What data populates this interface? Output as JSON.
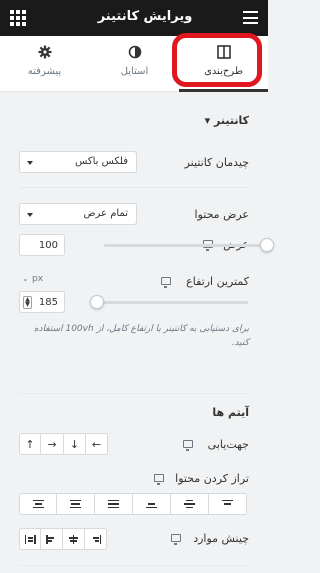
{
  "header": {
    "title": "ویرایش کانتینر"
  },
  "tabs": [
    {
      "label": "طرح‌بندی",
      "icon": "layout-icon",
      "active": true
    },
    {
      "label": "استایل",
      "icon": "half-circle-icon",
      "active": false
    },
    {
      "label": "پیشرفته",
      "icon": "gear-icon",
      "active": false
    }
  ],
  "container_section": {
    "title": "کانتینر",
    "container_type": {
      "label": "چیدمان کانتینر",
      "value": "فلکس باکس"
    },
    "content_width": {
      "label": "عرض محتوا",
      "value": "تمام عرض"
    },
    "width": {
      "label": "عرض",
      "unit": "%",
      "value": "100",
      "slider_fraction": 1.0
    },
    "min_height": {
      "label": "کمترین ارتفاع",
      "unit": "px",
      "value": "185",
      "slider_fraction": 0.0
    },
    "description": "برای دستیابی به کانتینر با ارتفاع کامل، از 100vh استفاده کنید."
  },
  "items_section": {
    "title": "آیتم ها",
    "direction": {
      "label": "جهت‌یابی",
      "buttons": [
        "←",
        "↓",
        "→",
        "↑"
      ]
    },
    "justify": {
      "label": "تراز کردن محتوا"
    },
    "align": {
      "label": "چینش موارد"
    }
  },
  "colors": {
    "header_bg": "#1a1a1a",
    "highlight": "#e0171f",
    "panel_bg": "#f1f2f3"
  }
}
